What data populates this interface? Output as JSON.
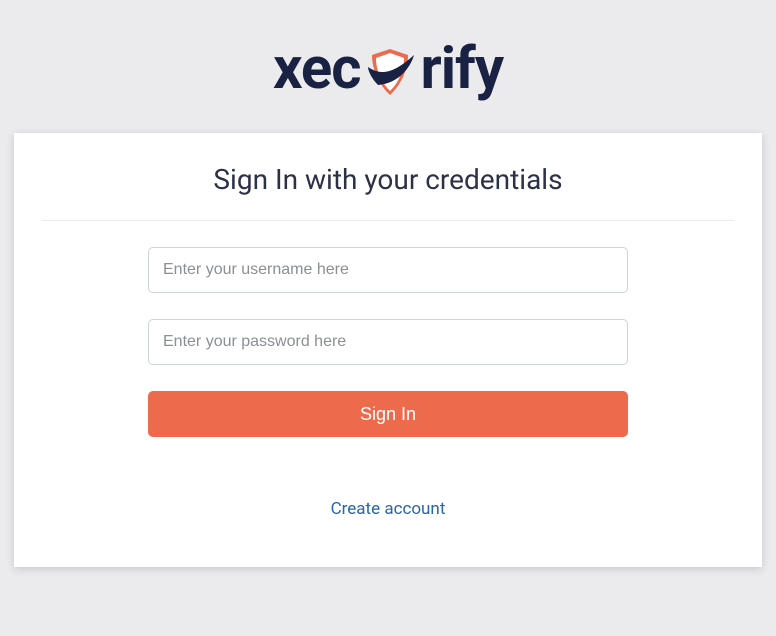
{
  "brand": {
    "name_left": "xec",
    "name_right": "rify",
    "icon": "shield-check-icon"
  },
  "card": {
    "heading": "Sign In with your credentials"
  },
  "form": {
    "username_placeholder": "Enter your username here",
    "password_placeholder": "Enter your password here",
    "signin_label": "Sign In"
  },
  "links": {
    "create_account": "Create account"
  },
  "colors": {
    "accent": "#ec6b4d",
    "link": "#2766a8",
    "heading": "#2c3148",
    "page_bg": "#ebebee"
  }
}
